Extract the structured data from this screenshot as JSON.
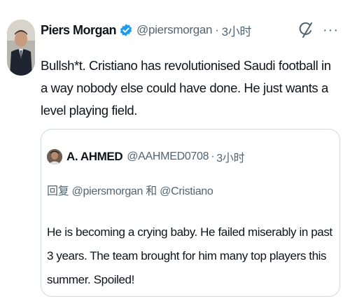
{
  "tweet": {
    "author": {
      "display_name": "Piers Morgan",
      "handle": "@piersmorgan",
      "verified_icon": "verified-badge-icon",
      "avatar": "avatar-photo"
    },
    "separator": "·",
    "time": "3小时",
    "text": "Bullsh*t. Cristiano has revolutionised Saudi football in a way nobody else could have done. He just wants a level playing field.",
    "more_icon_glyph": "···",
    "quoted": {
      "author": {
        "display_name": "A. AHMED",
        "handle": "@AAHMED0708"
      },
      "separator": "·",
      "time": "3小时",
      "reply_prefix": "回复 ",
      "reply_mention_1": "@piersmorgan",
      "reply_joiner": " 和 ",
      "reply_mention_2": "@Cristiano",
      "text": "He is becoming a crying baby. He failed miserably in past 3 years. The team brought for him many top players this summer. Spoiled!"
    }
  },
  "colors": {
    "text_primary": "#0f1419",
    "text_secondary": "#536471",
    "verified_blue": "#1d9bf0",
    "border": "#cfd9de"
  }
}
